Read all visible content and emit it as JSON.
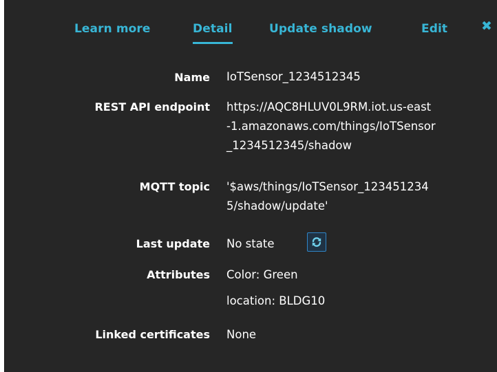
{
  "tabs": {
    "learn_more": "Learn more",
    "detail": "Detail",
    "update_shadow": "Update shadow",
    "edit": "Edit",
    "close_icon": "close-icon"
  },
  "details": {
    "name": {
      "label": "Name",
      "value": "IoTSensor_1234512345"
    },
    "rest_api": {
      "label": "REST API endpoint",
      "lines": [
        "https://AQC8HLUV0L9RM.iot.us-east",
        "-1.amazonaws.com/things/IoTSensor",
        "_1234512345/shadow"
      ]
    },
    "mqtt": {
      "label": "MQTT topic",
      "lines": [
        "'$aws/things/IoTSensor_123451234",
        "5/shadow/update'"
      ]
    },
    "last_update": {
      "label": "Last update",
      "value": "No state",
      "refresh_icon": "refresh-icon"
    },
    "attributes": {
      "label": "Attributes",
      "items": [
        "Color: Green",
        "location: BLDG10"
      ]
    },
    "linked_certificates": {
      "label": "Linked certificates",
      "value": "None"
    }
  },
  "colors": {
    "panel_bg": "#262626",
    "accent": "#38b6d6",
    "text": "#ffffff"
  }
}
